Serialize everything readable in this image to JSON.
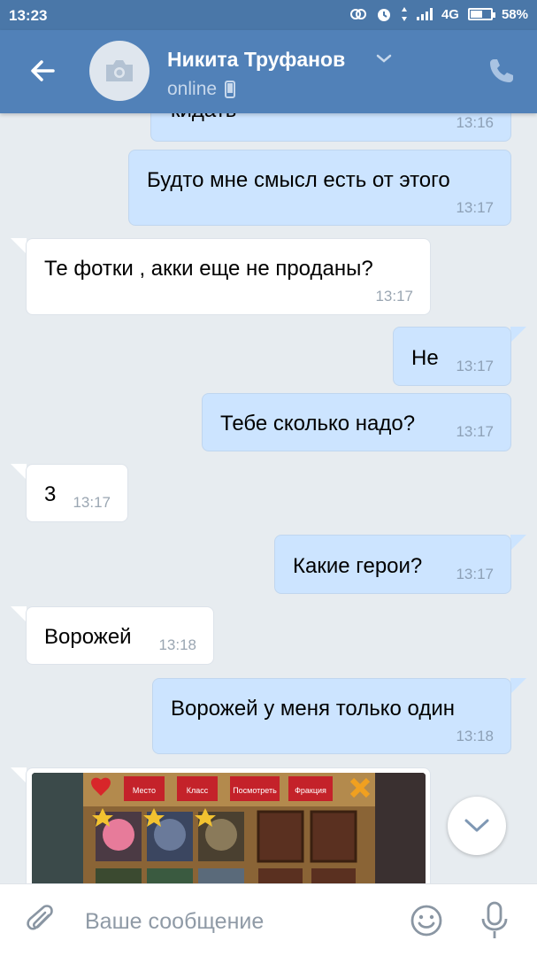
{
  "status_bar": {
    "time": "13:23",
    "network": "4G",
    "battery": "58%",
    "battery_level": 0.58
  },
  "header": {
    "contact_name": "Никита Труфанов",
    "status": "online",
    "icons": {
      "back": "arrow-left-icon",
      "avatar": "camera-icon",
      "dropdown": "chevron-down-icon",
      "device": "mobile-phone-icon",
      "call": "phone-icon"
    }
  },
  "messages": [
    {
      "direction": "out",
      "text": "кидать",
      "time": "13:16"
    },
    {
      "direction": "out",
      "text": "Будто мне смысл есть от этого",
      "time": "13:17"
    },
    {
      "direction": "in",
      "text": "Те фотки , акки еще не проданы?",
      "time": "13:17"
    },
    {
      "direction": "out",
      "text": "Не",
      "time": "13:17"
    },
    {
      "direction": "out",
      "text": "Тебе сколько надо?",
      "time": "13:17"
    },
    {
      "direction": "in",
      "text": "3",
      "time": "13:17"
    },
    {
      "direction": "out",
      "text": "Какие герои?",
      "time": "13:17"
    },
    {
      "direction": "in",
      "text": "Ворожей",
      "time": "13:18"
    },
    {
      "direction": "out",
      "text": "Ворожей у меня только один",
      "time": "13:18"
    }
  ],
  "attachment": {
    "type": "game-screenshot",
    "tabs": [
      "Место",
      "Класс",
      "Посмотреть",
      "Фракция"
    ]
  },
  "composer": {
    "placeholder": "Ваше сообщение",
    "icons": {
      "attach": "paperclip-icon",
      "emoji": "smile-icon",
      "voice": "microphone-icon",
      "scroll": "chevron-down-icon"
    }
  },
  "colors": {
    "header": "#5181b8",
    "status_bar": "#4a77a8",
    "background": "#e7ecf0",
    "outgoing_bubble": "#cce4ff",
    "incoming_bubble": "#ffffff"
  }
}
